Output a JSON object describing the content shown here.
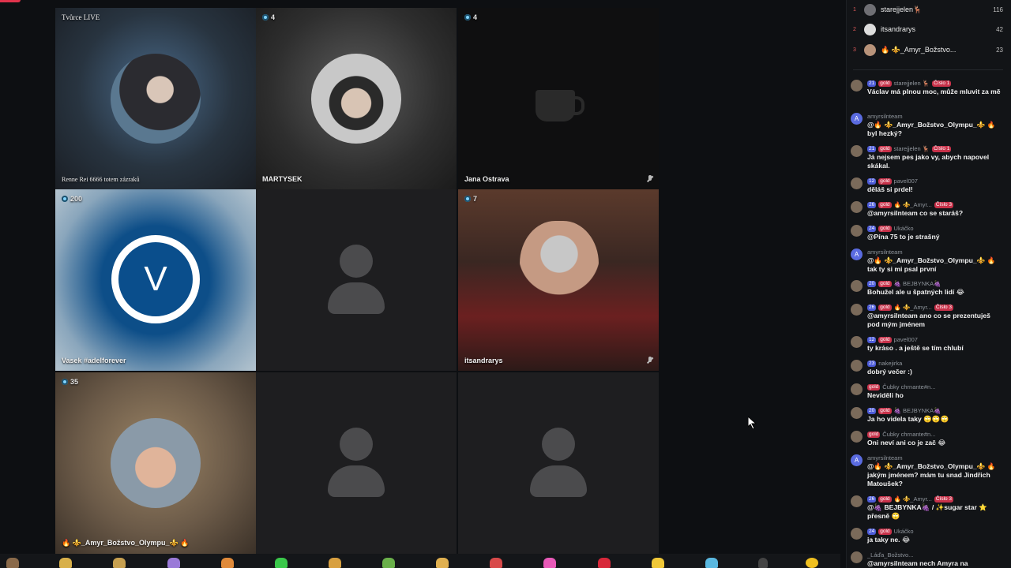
{
  "grid": {
    "tiles": [
      {
        "top_label": "Tvůrce LIVE",
        "name": "Renne Rei 6666 totem zázraků"
      },
      {
        "viewers": "4",
        "name": "MARTYSEK"
      },
      {
        "viewers": "4",
        "name": "Jana Ostrava"
      },
      {
        "viewers": "200",
        "name": "Vasek #adelforever",
        "avatar_letter": "V"
      },
      {
        "viewers": "",
        "name": ""
      },
      {
        "viewers": "7",
        "name": "itsandrarys"
      },
      {
        "viewers": "35",
        "name": "🔥 ⚜️_Amyr_Božstvo_Olympu_⚜️ 🔥"
      },
      {
        "viewers": "",
        "name": ""
      },
      {
        "viewers": "",
        "name": ""
      }
    ]
  },
  "leaderboard": [
    {
      "rank": "1",
      "name": "starejjelen🦌",
      "score": "116"
    },
    {
      "rank": "2",
      "name": "itsandrarys",
      "score": "42"
    },
    {
      "rank": "3",
      "name": "🔥 ⚜️_Amyr_Božstvo...",
      "score": "23"
    }
  ],
  "chat": [
    {
      "level": "21",
      "gold": "gold",
      "user": "starejjelen 🦌",
      "extra": "Číslo 1",
      "text": "Václav má plnou moc, může mluvit za mě"
    },
    {
      "level": "",
      "gold": "",
      "user": "amyrsilnteam",
      "extra": "",
      "avatar_letter": "A",
      "text": "@🔥 ⚜️_Amyr_Božstvo_Olympu_⚜️ 🔥 byl hezký?"
    },
    {
      "level": "21",
      "gold": "gold",
      "user": "starejjelen 🦌",
      "extra": "Číslo 1",
      "text": "Já nejsem pes jako vy, abych napovel skákal."
    },
    {
      "level": "12",
      "gold": "gold",
      "user": "pavel007",
      "extra": "",
      "text": "děláš si prdel!"
    },
    {
      "level": "26",
      "gold": "gold",
      "user": "🔥 ⚜️_Amyr...",
      "extra": "Číslo 3",
      "text": "@amyrsilnteam co se staráš?"
    },
    {
      "level": "24",
      "gold": "gold",
      "user": "Ukáčko",
      "extra": "",
      "text": "@Pína 75 to je strašný"
    },
    {
      "level": "",
      "gold": "",
      "user": "amyrsilnteam",
      "extra": "",
      "avatar_letter": "A",
      "text": "@🔥 ⚜️_Amyr_Božstvo_Olympu_⚜️ 🔥 tak ty si mi psal první"
    },
    {
      "level": "20",
      "gold": "gold",
      "user": "🍇 BEJBYNKA🍇",
      "extra": "",
      "text": "Bohužel ale u špatných lidí 😂"
    },
    {
      "level": "26",
      "gold": "gold",
      "user": "🔥 ⚜️_Amyr...",
      "extra": "Číslo 3",
      "text": "@amyrsilnteam ano co se prezentuješ pod mým jménem"
    },
    {
      "level": "12",
      "gold": "gold",
      "user": "pavel007",
      "extra": "",
      "text": "ty kráso . a ještě se tím chlubí"
    },
    {
      "level": "23",
      "gold": "",
      "user": "nakejirka",
      "extra": "",
      "text": "dobrý večer :)"
    },
    {
      "level": "",
      "gold": "gold",
      "user": "Čubky chrnante#n...",
      "extra": "",
      "text": "Neviděli ho"
    },
    {
      "level": "20",
      "gold": "gold",
      "user": "🍇 BEJBYNKA🍇",
      "extra": "",
      "text": "Ja ho videla taky 🙄🙄🙄"
    },
    {
      "level": "",
      "gold": "gold",
      "user": "Čubky chrnante#n...",
      "extra": "",
      "text": "Oni neví ani co je zač 😂"
    },
    {
      "level": "",
      "gold": "",
      "user": "amyrsilnteam",
      "extra": "",
      "avatar_letter": "A",
      "text": "@🔥 ⚜️_Amyr_Božstvo_Olympu_⚜️ 🔥 jakým jménem? mám tu snad Jindřich Matoušek?"
    },
    {
      "level": "26",
      "gold": "gold",
      "user": "🔥 ⚜️_Amyr...",
      "extra": "Číslo 3",
      "text": "@🍇 BEJBYNKA🍇 / ✨sugar star ⭐ přesně 🙄"
    },
    {
      "level": "24",
      "gold": "gold",
      "user": "Ukáčko",
      "extra": "",
      "text": "ja taky ne. 😂"
    },
    {
      "level": "",
      "gold": "",
      "user": "_Láďa_Božstvo...",
      "extra": "",
      "text": "@amyrsilnteam nech Amyra na"
    }
  ]
}
